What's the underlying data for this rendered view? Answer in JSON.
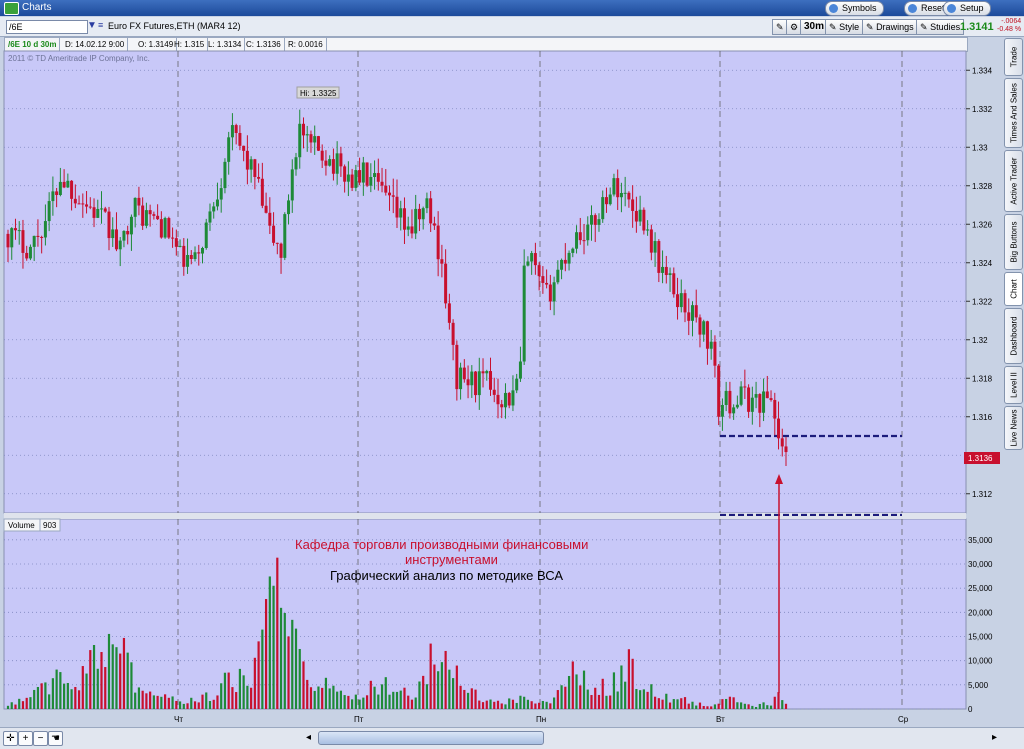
{
  "window": {
    "title": "Charts",
    "buttons": [
      "Symbols",
      "Reset",
      "Setup"
    ]
  },
  "toolbar": {
    "symbol": "/6E",
    "product": "Euro FX Futures,ETH (MAR4 12)",
    "timeframe": "30m",
    "style": "Style",
    "drawings": "Drawings",
    "studies": "Studies",
    "last_price": "1.3141",
    "change_abs": "-.0064",
    "change_pct": "-0.48 %"
  },
  "infobar": {
    "symbol": "/6E 10 d 30m",
    "date": "D: 14.02.12 9:00",
    "open": "O: 1.3149",
    "high": "H: 1.315",
    "low": "L: 1.3134",
    "close": "C: 1.3136",
    "range": "R: 0.0016"
  },
  "copyright": "2011 © TD Ameritrade IP Company, Inc.",
  "volume_panel": {
    "label": "Volume",
    "value": "903"
  },
  "side_tabs": [
    "Trade",
    "Times And Sales",
    "Active Trader",
    "Big Buttons",
    "Chart",
    "Dashboard",
    "Level II",
    "Live News"
  ],
  "annotations": {
    "title1": "Кафедра торговли производными финансовыми",
    "title2": "инструментами",
    "subtitle": "Графический анализ по методике ВСА",
    "hi_label": "Hi: 1.3325"
  },
  "colors": {
    "background": "#c8c8f8",
    "up": "#1e8a38",
    "down": "#c8102e",
    "level": "#1c1c7c"
  },
  "chart_data": [
    {
      "type": "candlestick",
      "ylim": [
        1.311,
        1.335
      ],
      "y_ticks": [
        "1.334",
        "1.332",
        "1.33",
        "1.328",
        "1.326",
        "1.324",
        "1.322",
        "1.32",
        "1.318",
        "1.316",
        "1.314",
        "1.312"
      ],
      "x_ticks": [
        "Чт",
        "Пт",
        "Пн",
        "Вт",
        "Ср"
      ],
      "price_label": "1.3136",
      "levels": [
        1.315,
        1.3109
      ],
      "hi": 1.3325,
      "waypoints": [
        [
          0,
          1.3255
        ],
        [
          6,
          1.3248
        ],
        [
          10,
          1.3262
        ],
        [
          14,
          1.3285
        ],
        [
          20,
          1.3272
        ],
        [
          24,
          1.3265
        ],
        [
          27,
          1.3258
        ],
        [
          30,
          1.3245
        ],
        [
          33,
          1.327
        ],
        [
          36,
          1.3265
        ],
        [
          40,
          1.3262
        ],
        [
          44,
          1.3252
        ],
        [
          46,
          1.3242
        ],
        [
          50,
          1.324
        ],
        [
          54,
          1.3265
        ],
        [
          57,
          1.3285
        ],
        [
          59,
          1.3308
        ],
        [
          62,
          1.33
        ],
        [
          66,
          1.3285
        ],
        [
          68,
          1.327
        ],
        [
          70,
          1.3255
        ],
        [
          73,
          1.3245
        ],
        [
          76,
          1.329
        ],
        [
          78,
          1.331
        ],
        [
          80,
          1.33
        ],
        [
          84,
          1.3298
        ],
        [
          88,
          1.329
        ],
        [
          92,
          1.3283
        ],
        [
          95,
          1.3286
        ],
        [
          99,
          1.3278
        ],
        [
          102,
          1.327
        ],
        [
          105,
          1.3262
        ],
        [
          108,
          1.3258
        ],
        [
          112,
          1.327
        ],
        [
          114,
          1.3256
        ],
        [
          116,
          1.324
        ],
        [
          118,
          1.3205
        ],
        [
          120,
          1.318
        ],
        [
          124,
          1.3178
        ],
        [
          128,
          1.3178
        ],
        [
          132,
          1.317
        ],
        [
          135,
          1.317
        ],
        [
          137,
          1.3185
        ],
        [
          138,
          1.3235
        ],
        [
          140,
          1.324
        ],
        [
          142,
          1.3228
        ],
        [
          144,
          1.3222
        ],
        [
          148,
          1.324
        ],
        [
          152,
          1.3255
        ],
        [
          156,
          1.3258
        ],
        [
          160,
          1.3276
        ],
        [
          163,
          1.328
        ],
        [
          166,
          1.3272
        ],
        [
          170,
          1.3262
        ],
        [
          174,
          1.324
        ],
        [
          178,
          1.3225
        ],
        [
          182,
          1.3215
        ],
        [
          186,
          1.3205
        ],
        [
          188,
          1.3195
        ],
        [
          190,
          1.3165
        ],
        [
          193,
          1.3168
        ],
        [
          196,
          1.317
        ],
        [
          200,
          1.3168
        ],
        [
          204,
          1.317
        ],
        [
          206,
          1.315
        ],
        [
          208,
          1.3136
        ]
      ],
      "candle_count": 209
    },
    {
      "type": "bar",
      "series": [
        {
          "name": "Volume"
        }
      ],
      "ylim": [
        0,
        36000
      ],
      "y_ticks": [
        "35,000",
        "30,000",
        "25,000",
        "20,000",
        "15,000",
        "10,000",
        "5,000",
        "0"
      ],
      "peaks": [
        [
          0,
          1500
        ],
        [
          5,
          2500
        ],
        [
          10,
          6000
        ],
        [
          14,
          9000
        ],
        [
          18,
          4500
        ],
        [
          22,
          13000
        ],
        [
          25,
          11000
        ],
        [
          27,
          17000
        ],
        [
          29,
          26000
        ],
        [
          31,
          15000
        ],
        [
          34,
          8000
        ],
        [
          38,
          4000
        ],
        [
          42,
          3000
        ],
        [
          48,
          2000
        ],
        [
          54,
          4000
        ],
        [
          58,
          7000
        ],
        [
          62,
          8000
        ],
        [
          66,
          10000
        ],
        [
          70,
          27000
        ],
        [
          72,
          34000
        ],
        [
          74,
          25000
        ],
        [
          76,
          21000
        ],
        [
          80,
          11000
        ],
        [
          84,
          7000
        ],
        [
          88,
          4000
        ],
        [
          92,
          2000
        ],
        [
          96,
          5000
        ],
        [
          100,
          7000
        ],
        [
          104,
          6000
        ],
        [
          108,
          4000
        ],
        [
          112,
          10000
        ],
        [
          113,
          18000
        ],
        [
          115,
          14000
        ],
        [
          118,
          11000
        ],
        [
          122,
          6000
        ],
        [
          126,
          3000
        ],
        [
          130,
          1500
        ],
        [
          134,
          2000
        ],
        [
          138,
          3500
        ],
        [
          142,
          1500
        ],
        [
          146,
          2500
        ],
        [
          150,
          9000
        ],
        [
          152,
          10000
        ],
        [
          156,
          5000
        ],
        [
          160,
          6000
        ],
        [
          164,
          9000
        ],
        [
          166,
          14000
        ],
        [
          168,
          8000
        ],
        [
          172,
          5000
        ],
        [
          176,
          3000
        ],
        [
          180,
          2500
        ],
        [
          184,
          1500
        ],
        [
          188,
          1000
        ],
        [
          192,
          3000
        ],
        [
          196,
          1500
        ],
        [
          200,
          1000
        ],
        [
          204,
          1500
        ],
        [
          206,
          4000
        ],
        [
          208,
          1500
        ]
      ]
    }
  ]
}
